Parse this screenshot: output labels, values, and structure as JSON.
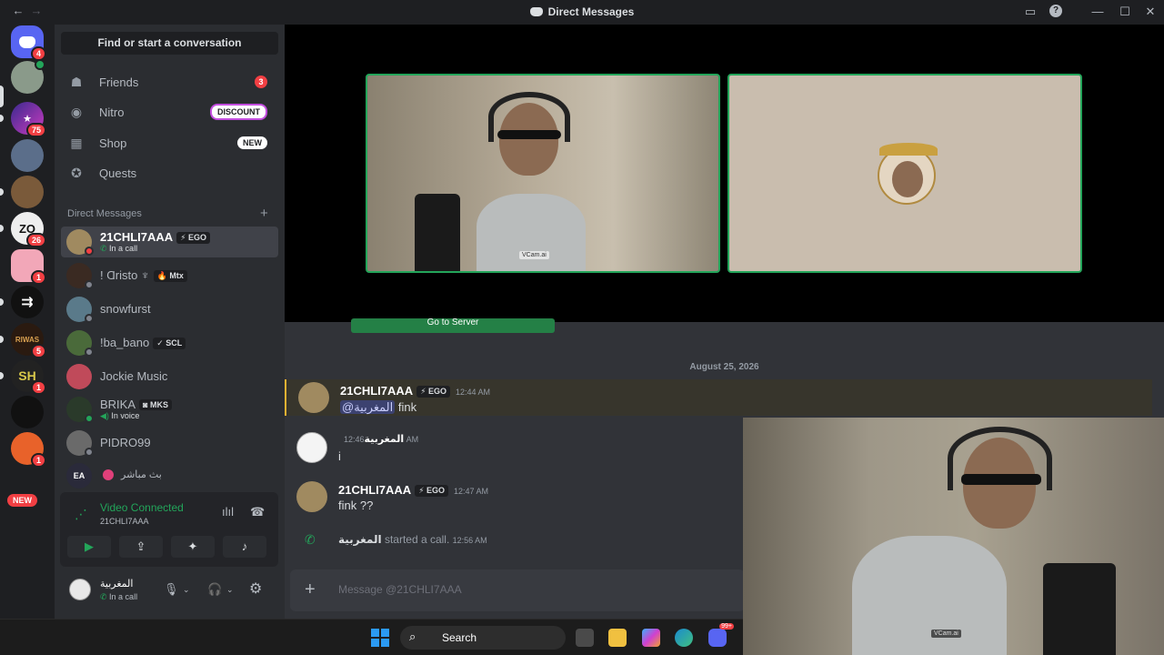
{
  "window": {
    "title": "Direct Messages",
    "back": "←",
    "forward": "→",
    "inbox": "▭",
    "help": "?",
    "minimize": "—",
    "maximize": "☐",
    "close": "✕"
  },
  "servers": {
    "items": [
      {
        "name": "discord-home-icon",
        "badge": "4"
      },
      {
        "name": "server-avatar-1",
        "badge": ""
      },
      {
        "name": "server-star",
        "badge": "75"
      },
      {
        "name": "server-avatar-3",
        "badge": ""
      },
      {
        "name": "server-avatar-4",
        "badge": ""
      },
      {
        "name": "server-zo",
        "badge": "26"
      },
      {
        "name": "server-pink",
        "badge": "1"
      },
      {
        "name": "server-arrow",
        "badge": ""
      },
      {
        "name": "server-riwas",
        "badge": "5"
      },
      {
        "name": "server-sh",
        "badge": "1"
      },
      {
        "name": "server-dark",
        "badge": ""
      },
      {
        "name": "server-red-bird",
        "badge": "1"
      }
    ],
    "new_label": "NEW"
  },
  "sidebar": {
    "find": "Find or start a conversation",
    "nav": [
      {
        "label": "Friends",
        "icon": "friends-icon",
        "glyph": "☗",
        "badge": "3"
      },
      {
        "label": "Nitro",
        "icon": "nitro-icon",
        "glyph": "◉",
        "tag": "DISCOUNT"
      },
      {
        "label": "Shop",
        "icon": "shop-icon",
        "glyph": "▦",
        "tag": "NEW"
      },
      {
        "label": "Quests",
        "icon": "quests-icon",
        "glyph": "✪"
      }
    ],
    "dm_header": "Direct Messages",
    "dm_plus": "+",
    "dms": [
      {
        "name": "21CHLI7AAA",
        "chip": "⚡ EGO",
        "sub": "In a call"
      },
      {
        "name": "! Ɑristo ♆",
        "chip": "🔥 Mtx"
      },
      {
        "name": "snowfurst"
      },
      {
        "name": "!ba_bano",
        "chip": "✓ SCL"
      },
      {
        "name": "Jockie Music"
      },
      {
        "name": "BRIKA",
        "chip": "◙ MKS",
        "sub": "In voice"
      },
      {
        "name": "PIDRO99"
      },
      {
        "name": "بث مباشر"
      }
    ]
  },
  "voice": {
    "status": "Video Connected",
    "channel": "21CHLI7AAA",
    "buttons": {
      "camera": "▶",
      "screen": "⇪",
      "activity": "✦",
      "soundboard": "♪"
    }
  },
  "user": {
    "name": "المغربية",
    "status": "In a call"
  },
  "chat": {
    "go_server": "Go to Server",
    "date": "August 25, 2026",
    "messages": [
      {
        "author": "21CHLI7AAA",
        "chip": "⚡ EGO",
        "time": "12:44 AM",
        "mention": "@المغربية",
        "text": "fink"
      },
      {
        "author": "المغربية",
        "time": "12:46 AM",
        "text": "i"
      },
      {
        "author": "21CHLI7AAA",
        "chip": "⚡ EGO",
        "time": "12:47 AM",
        "text": "fink ??"
      }
    ],
    "call": {
      "author": "المغربية",
      "text": "started a call.",
      "time": "12:56 AM"
    },
    "composer_placeholder": "Message @21CHLI7AAA",
    "composer_plus": "+"
  },
  "video": {
    "watermark": "VCam.ai",
    "watermark_mirror": "VCam.ai"
  },
  "taskbar": {
    "search": "Search",
    "discord_badge": "99+"
  }
}
